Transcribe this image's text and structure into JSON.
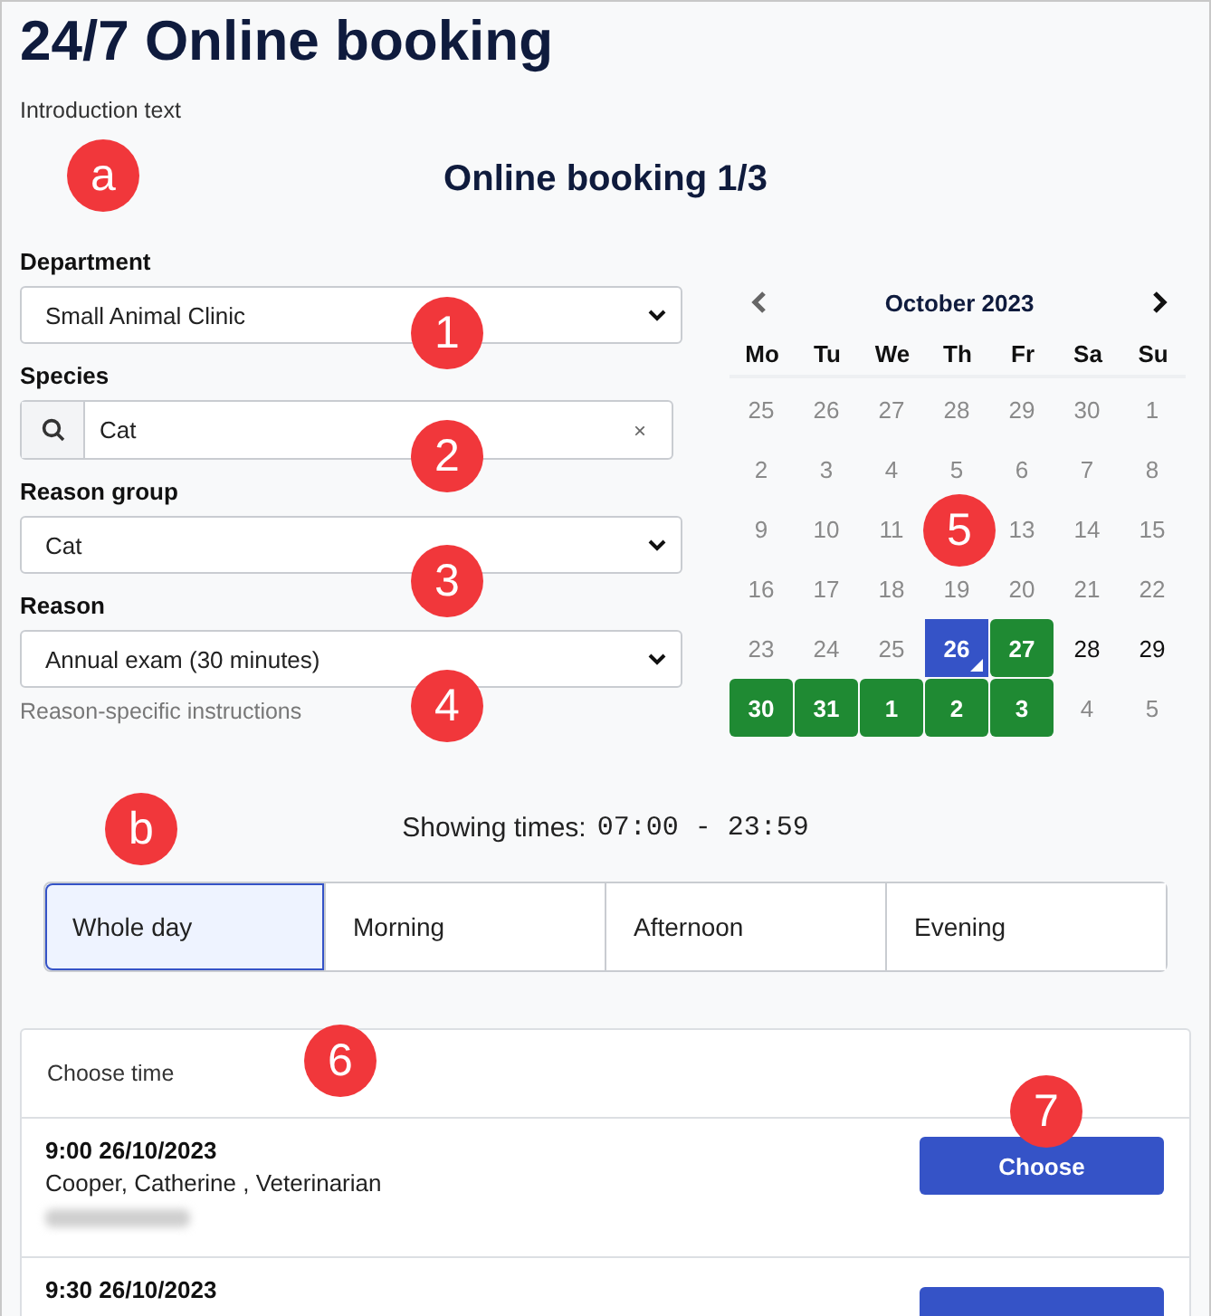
{
  "title": "24/7 Online booking",
  "intro": "Introduction text",
  "step_title": "Online booking 1/3",
  "fields": [
    {
      "kind": "select",
      "label": "Department",
      "value": "Small Animal Clinic"
    },
    {
      "kind": "search",
      "label": "Species",
      "value": "Cat",
      "clear": "×"
    },
    {
      "kind": "select",
      "label": "Reason group",
      "value": "Cat"
    },
    {
      "kind": "select",
      "label": "Reason",
      "value": "Annual exam (30 minutes)"
    }
  ],
  "instructions": "Reason-specific instructions",
  "calendar": {
    "month": "October 2023",
    "weekdays": [
      "Mo",
      "Tu",
      "We",
      "Th",
      "Fr",
      "Sa",
      "Su"
    ],
    "days": [
      {
        "label": "25",
        "disabled": true,
        "available": false,
        "selected": false
      },
      {
        "label": "26",
        "disabled": true,
        "available": false,
        "selected": false
      },
      {
        "label": "27",
        "disabled": true,
        "available": false,
        "selected": false
      },
      {
        "label": "28",
        "disabled": true,
        "available": false,
        "selected": false
      },
      {
        "label": "29",
        "disabled": true,
        "available": false,
        "selected": false
      },
      {
        "label": "30",
        "disabled": true,
        "available": false,
        "selected": false
      },
      {
        "label": "1",
        "disabled": true,
        "available": false,
        "selected": false
      },
      {
        "label": "2",
        "disabled": true,
        "available": false,
        "selected": false
      },
      {
        "label": "3",
        "disabled": true,
        "available": false,
        "selected": false
      },
      {
        "label": "4",
        "disabled": true,
        "available": false,
        "selected": false
      },
      {
        "label": "5",
        "disabled": true,
        "available": false,
        "selected": false
      },
      {
        "label": "6",
        "disabled": true,
        "available": false,
        "selected": false
      },
      {
        "label": "7",
        "disabled": true,
        "available": false,
        "selected": false
      },
      {
        "label": "8",
        "disabled": true,
        "available": false,
        "selected": false
      },
      {
        "label": "9",
        "disabled": true,
        "available": false,
        "selected": false
      },
      {
        "label": "10",
        "disabled": true,
        "available": false,
        "selected": false
      },
      {
        "label": "11",
        "disabled": true,
        "available": false,
        "selected": false
      },
      {
        "covered": true
      },
      {
        "label": "13",
        "disabled": true,
        "available": false,
        "selected": false
      },
      {
        "label": "14",
        "disabled": true,
        "available": false,
        "selected": false
      },
      {
        "label": "15",
        "disabled": true,
        "available": false,
        "selected": false
      },
      {
        "label": "16",
        "disabled": true,
        "available": false,
        "selected": false
      },
      {
        "label": "17",
        "disabled": true,
        "available": false,
        "selected": false
      },
      {
        "label": "18",
        "disabled": true,
        "available": false,
        "selected": false
      },
      {
        "label": "19",
        "disabled": true,
        "available": false,
        "selected": false
      },
      {
        "label": "20",
        "disabled": true,
        "available": false,
        "selected": false
      },
      {
        "label": "21",
        "disabled": true,
        "available": false,
        "selected": false
      },
      {
        "label": "22",
        "disabled": true,
        "available": false,
        "selected": false
      },
      {
        "label": "23",
        "disabled": true,
        "available": false,
        "selected": false
      },
      {
        "label": "24",
        "disabled": true,
        "available": false,
        "selected": false
      },
      {
        "label": "25",
        "disabled": true,
        "available": false,
        "selected": false
      },
      {
        "label": "26",
        "selected": true
      },
      {
        "label": "27",
        "disabled": false,
        "available": true,
        "selected": false
      },
      {
        "label": "28",
        "disabled": false,
        "available": false,
        "selected": false
      },
      {
        "label": "29",
        "disabled": false,
        "available": false,
        "selected": false
      },
      {
        "label": "30",
        "disabled": false,
        "available": true,
        "selected": false
      },
      {
        "label": "31",
        "disabled": false,
        "available": true,
        "selected": false
      },
      {
        "label": "1",
        "disabled": false,
        "available": true,
        "selected": false
      },
      {
        "label": "2",
        "disabled": false,
        "available": true,
        "selected": false
      },
      {
        "label": "3",
        "disabled": false,
        "available": true,
        "selected": false
      },
      {
        "label": "4",
        "disabled": true,
        "available": false,
        "selected": false
      },
      {
        "label": "5",
        "disabled": true,
        "available": false,
        "selected": false
      }
    ]
  },
  "showing_label": "Showing times:",
  "showing_range": "07:00 - 23:59",
  "tabs": [
    {
      "label": "Whole day",
      "selected": true
    },
    {
      "label": "Morning",
      "selected": false
    },
    {
      "label": "Afternoon",
      "selected": false
    },
    {
      "label": "Evening",
      "selected": false
    }
  ],
  "slots_header": "Choose time",
  "slots": [
    {
      "time": "9:00 26/10/2023",
      "staff": "Cooper, Catherine , Veterinarian",
      "button": "Choose",
      "blurred": true
    },
    {
      "time": "9:30 26/10/2023",
      "blurred": false
    }
  ],
  "markers": [
    "a",
    "1",
    "2",
    "3",
    "4",
    "5",
    "b",
    "6",
    "7"
  ]
}
